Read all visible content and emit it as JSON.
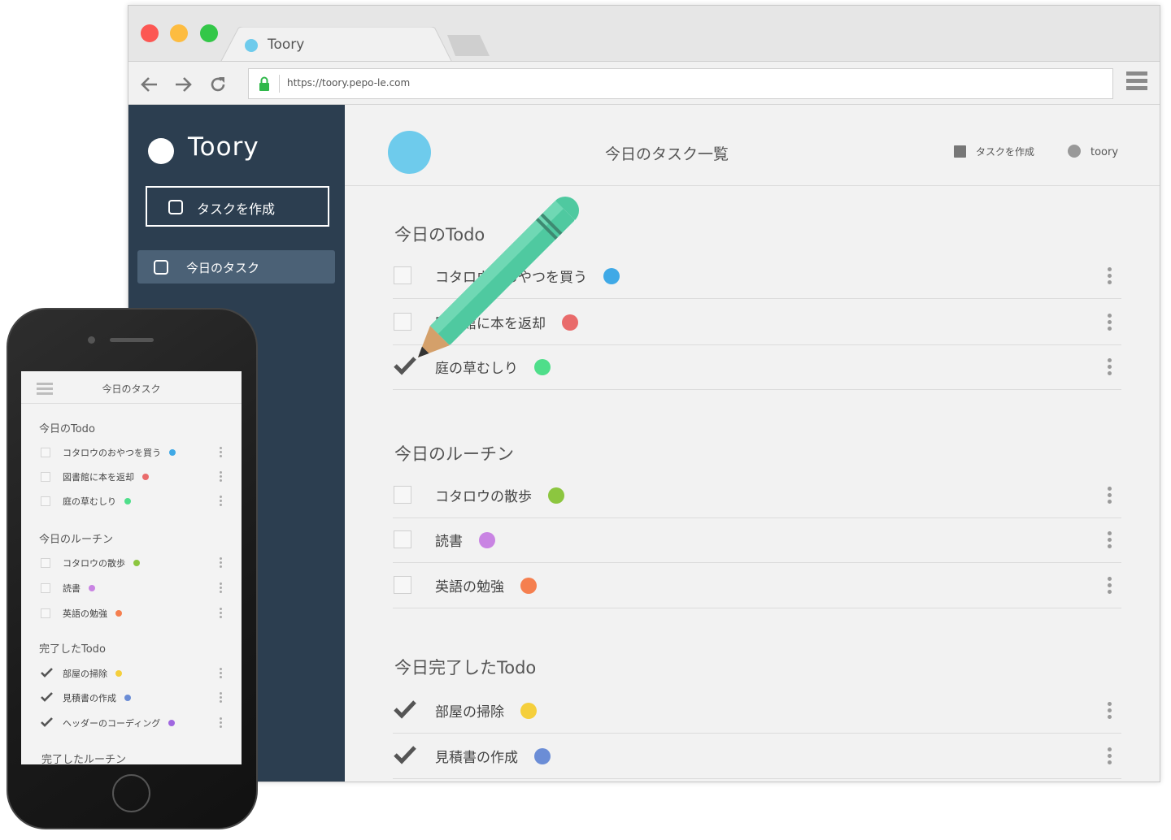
{
  "browser": {
    "tab_title": "Toory",
    "url": "https://toory.pepo-le.com"
  },
  "sidebar": {
    "app_name": "Toory",
    "create_button": "タスクを作成",
    "items": [
      {
        "label": "今日のタスク"
      }
    ]
  },
  "header": {
    "title": "今日のタスク一覧",
    "create_link": "タスクを作成",
    "user_name": "toory"
  },
  "sections": [
    {
      "title": "今日のTodo",
      "tasks": [
        {
          "label": "コタロウのおやつを買う",
          "color": "#3fa9e6",
          "checked": false
        },
        {
          "label": "図書館に本を返却",
          "color": "#e96b6b",
          "checked": false
        },
        {
          "label": "庭の草むしり",
          "color": "#4fde8a",
          "checked": true
        }
      ]
    },
    {
      "title": "今日のルーチン",
      "tasks": [
        {
          "label": "コタロウの散歩",
          "color": "#8cc63f",
          "checked": false
        },
        {
          "label": "読書",
          "color": "#c984e3",
          "checked": false
        },
        {
          "label": "英語の勉強",
          "color": "#f57f4f",
          "checked": false
        }
      ]
    },
    {
      "title": "今日完了したTodo",
      "tasks": [
        {
          "label": "部屋の掃除",
          "color": "#f5cf3c",
          "checked": true
        },
        {
          "label": "見積書の作成",
          "color": "#6b8dd6",
          "checked": true
        }
      ]
    }
  ],
  "phone": {
    "title": "今日のタスク",
    "sections": [
      {
        "title": "今日のTodo",
        "tasks": [
          {
            "label": "コタロウのおやつを買う",
            "color": "#3fa9e6",
            "checked": false
          },
          {
            "label": "図書館に本を返却",
            "color": "#e96b6b",
            "checked": false
          },
          {
            "label": "庭の草むしり",
            "color": "#4fde8a",
            "checked": false
          }
        ]
      },
      {
        "title": "今日のルーチン",
        "tasks": [
          {
            "label": "コタロウの散歩",
            "color": "#8cc63f",
            "checked": false
          },
          {
            "label": "読書",
            "color": "#c984e3",
            "checked": false
          },
          {
            "label": "英語の勉強",
            "color": "#f57f4f",
            "checked": false
          }
        ]
      },
      {
        "title": "完了したTodo",
        "tasks": [
          {
            "label": "部屋の掃除",
            "color": "#f5cf3c",
            "checked": true
          },
          {
            "label": "見積書の作成",
            "color": "#6b8dd6",
            "checked": true
          },
          {
            "label": "ヘッダーのコーディング",
            "color": "#a067e0",
            "checked": true
          }
        ]
      },
      {
        "title": "完了したルーチン",
        "tasks": []
      }
    ]
  },
  "icons": {
    "back": "arrow-left-icon",
    "forward": "arrow-right-icon",
    "reload": "reload-icon",
    "lock": "lock-icon",
    "menu": "hamburger-icon",
    "pencil": "pencil-illustration"
  }
}
